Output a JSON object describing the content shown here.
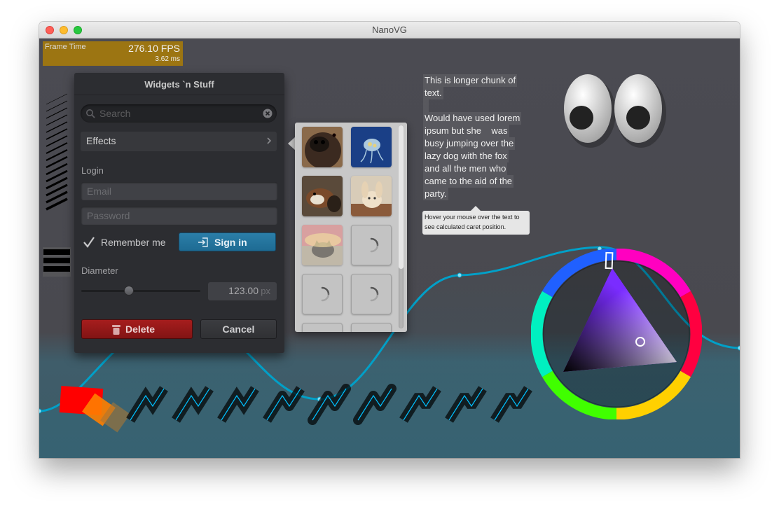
{
  "window": {
    "title": "NanoVG"
  },
  "perf": {
    "label": "Frame Time",
    "fps": "276.10 FPS",
    "ms": "3.62 ms"
  },
  "panel": {
    "title": "Widgets `n Stuff",
    "search_placeholder": "Search",
    "effects_label": "Effects",
    "login_label": "Login",
    "email_placeholder": "Email",
    "password_placeholder": "Password",
    "remember_label": "Remember me",
    "remember_checked": true,
    "signin_label": "Sign in",
    "diameter_label": "Diameter",
    "diameter_slider_fraction": 0.4,
    "diameter_value": "123.00",
    "diameter_unit": "px",
    "delete_label": "Delete",
    "cancel_label": "Cancel"
  },
  "thumbnails": {
    "items": [
      {
        "name": "dog-photo",
        "loaded": true
      },
      {
        "name": "jellyfish-photo",
        "loaded": true
      },
      {
        "name": "animal-photo",
        "loaded": true
      },
      {
        "name": "bunny-photo",
        "loaded": true
      },
      {
        "name": "cat-photo",
        "loaded": true
      },
      {
        "name": "loading",
        "loaded": false
      },
      {
        "name": "loading",
        "loaded": false
      },
      {
        "name": "loading",
        "loaded": false
      }
    ]
  },
  "text_box": {
    "lines": [
      "This is longer chunk of",
      "text.",
      "",
      "Would have used lorem",
      "ipsum but she    was",
      "busy jumping over the",
      "lazy dog with the fox",
      "and all the men who",
      "came to the aid of the",
      "party."
    ],
    "hint": "Hover your mouse over the text to see calculated caret position."
  },
  "colors": {
    "accent": "#1e7aa6",
    "delete": "#a61d1d",
    "graph": "#00a0c8",
    "fps_bg": "#b48200"
  }
}
